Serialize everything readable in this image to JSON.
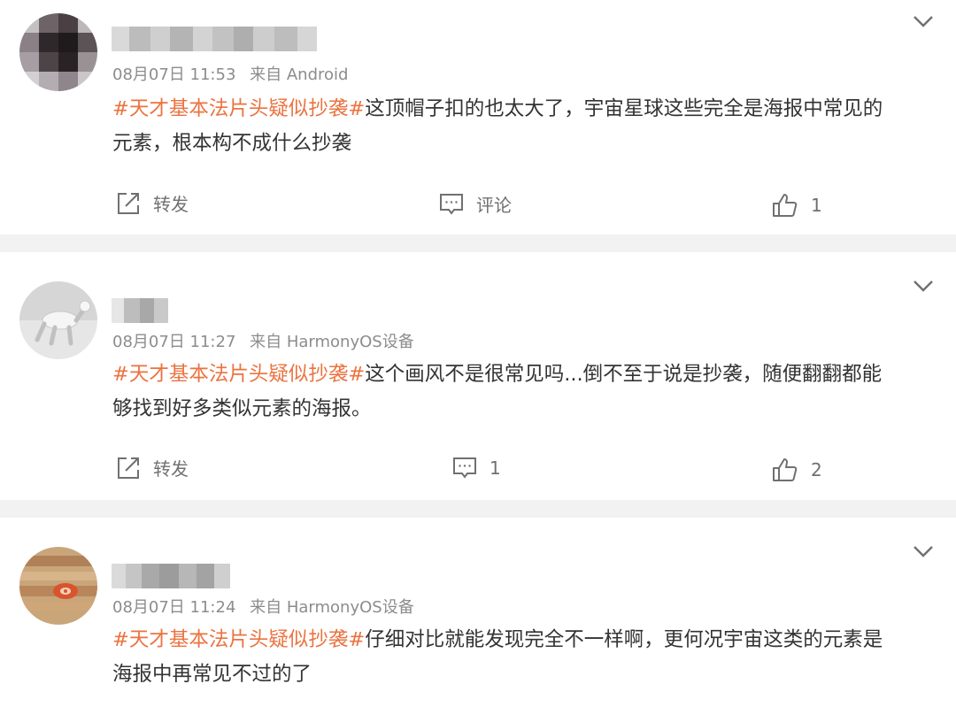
{
  "comments": [
    {
      "time": "08月07日 11:53",
      "source": "来自 Android",
      "hashtag": "#天才基本法片头疑似抄袭#",
      "text_line1": "这顶帽子扣的也太大了，宇宙星球这些完全是海报中常见的",
      "text_line2": "元素，根本构不成什么抄袭",
      "repost_label": "转发",
      "comment_label": "评论",
      "like_count": "1"
    },
    {
      "time": "08月07日 11:27",
      "source": "来自 HarmonyOS设备",
      "hashtag": "#天才基本法片头疑似抄袭#",
      "text_line1": "这个画风不是很常见吗...倒不至于说是抄袭，随便翻翻都能",
      "text_line2": "够找到好多类似元素的海报。",
      "repost_label": "转发",
      "comment_label": "1",
      "like_count": "2"
    },
    {
      "time": "08月07日 11:24",
      "source": "来自 HarmonyOS设备",
      "hashtag": "#天才基本法片头疑似抄袭#",
      "text_line1": "仔细对比就能发现完全不一样啊，更何况宇宙这类的元素是",
      "text_line2": "海报中再常见不过的了"
    }
  ],
  "icons": {
    "repost": "share-icon",
    "comment": "comment-icon",
    "like": "thumbs-up-icon",
    "menu": "chevron-down-icon"
  },
  "colors": {
    "hashtag": "#eb7340",
    "meta_text": "#8c8c8c",
    "separator": "#f2f2f2"
  }
}
